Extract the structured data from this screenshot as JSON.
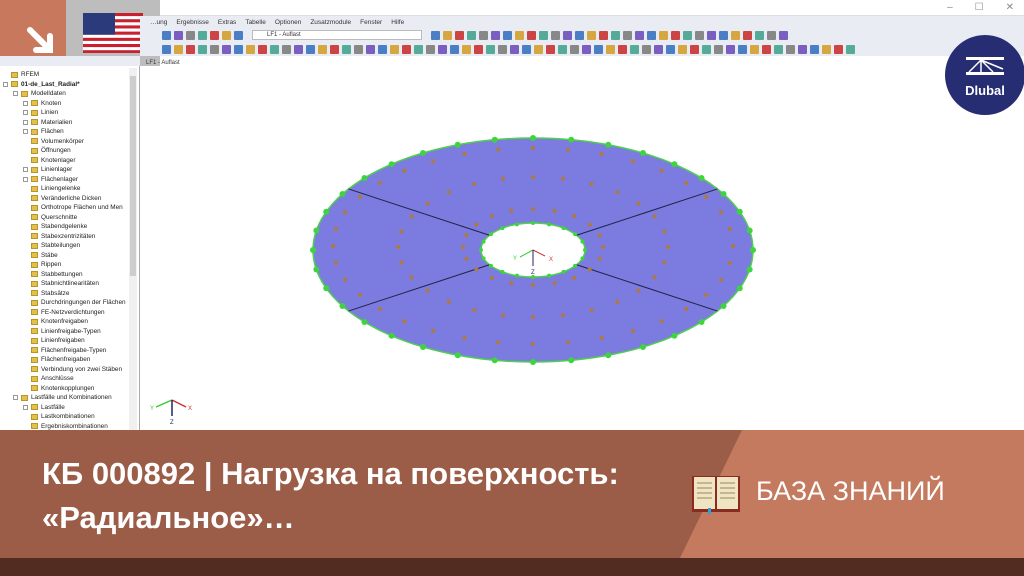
{
  "window": {
    "minimize": "–",
    "maximize": "☐",
    "close": "✕"
  },
  "menu": [
    "…ung",
    "Ergebnisse",
    "Extras",
    "Tabelle",
    "Optionen",
    "Zusatzmodule",
    "Fenster",
    "Hilfe"
  ],
  "toolbar": {
    "load_case": "LF1 - Auflast"
  },
  "view": {
    "label": "LF1 - Auflast"
  },
  "tree": [
    {
      "label": "RFEM",
      "level": 0,
      "exp": false
    },
    {
      "label": "01-de_Last_Radial*",
      "level": 0,
      "exp": true,
      "bold": true
    },
    {
      "label": "Modelldaten",
      "level": 1,
      "exp": true
    },
    {
      "label": "Knoten",
      "level": 2,
      "exp": true
    },
    {
      "label": "Linien",
      "level": 2,
      "exp": true
    },
    {
      "label": "Materialien",
      "level": 2,
      "exp": true
    },
    {
      "label": "Flächen",
      "level": 2,
      "exp": true
    },
    {
      "label": "Volumenkörper",
      "level": 2
    },
    {
      "label": "Öffnungen",
      "level": 2
    },
    {
      "label": "Knotenlager",
      "level": 2
    },
    {
      "label": "Linienlager",
      "level": 2,
      "exp": true
    },
    {
      "label": "Flächenlager",
      "level": 2,
      "exp": true
    },
    {
      "label": "Liniengelenke",
      "level": 2
    },
    {
      "label": "Veränderliche Dicken",
      "level": 2
    },
    {
      "label": "Orthotrope Flächen und Men",
      "level": 2
    },
    {
      "label": "Querschnitte",
      "level": 2
    },
    {
      "label": "Stabendgelenke",
      "level": 2
    },
    {
      "label": "Stabexzentrizitäten",
      "level": 2
    },
    {
      "label": "Stabteilungen",
      "level": 2
    },
    {
      "label": "Stäbe",
      "level": 2
    },
    {
      "label": "Rippen",
      "level": 2
    },
    {
      "label": "Stabbettungen",
      "level": 2
    },
    {
      "label": "Stabnichtlinearitäten",
      "level": 2
    },
    {
      "label": "Stabsätze",
      "level": 2
    },
    {
      "label": "Durchdringungen der Flächen",
      "level": 2
    },
    {
      "label": "FE-Netzverdichtungen",
      "level": 2
    },
    {
      "label": "Knotenfreigaben",
      "level": 2
    },
    {
      "label": "Linienfreigabe-Typen",
      "level": 2
    },
    {
      "label": "Linienfreigaben",
      "level": 2
    },
    {
      "label": "Flächenfreigabe-Typen",
      "level": 2
    },
    {
      "label": "Flächenfreigaben",
      "level": 2
    },
    {
      "label": "Verbindung von zwei Stäben",
      "level": 2
    },
    {
      "label": "Anschlüsse",
      "level": 2
    },
    {
      "label": "Knotenkopplungen",
      "level": 2
    },
    {
      "label": "Lastfälle und Kombinationen",
      "level": 1,
      "exp": true
    },
    {
      "label": "Lastfälle",
      "level": 2,
      "exp": true
    },
    {
      "label": "Lastkombinationen",
      "level": 2
    },
    {
      "label": "Ergebniskombinationen",
      "level": 2
    }
  ],
  "axes": {
    "x": "X",
    "y": "Y",
    "z": "Z"
  },
  "logo": {
    "text": "Dlubal"
  },
  "banner": {
    "title": "КБ 000892 | Нагрузка на поверхность: «Радиальное»…",
    "category": "БАЗА ЗНАНИЙ"
  },
  "colors": {
    "surface": "#7b7be0",
    "support": "#3fd43f",
    "banner": "#9c5d48",
    "accent": "#c47a5e",
    "logo": "#262d72"
  }
}
